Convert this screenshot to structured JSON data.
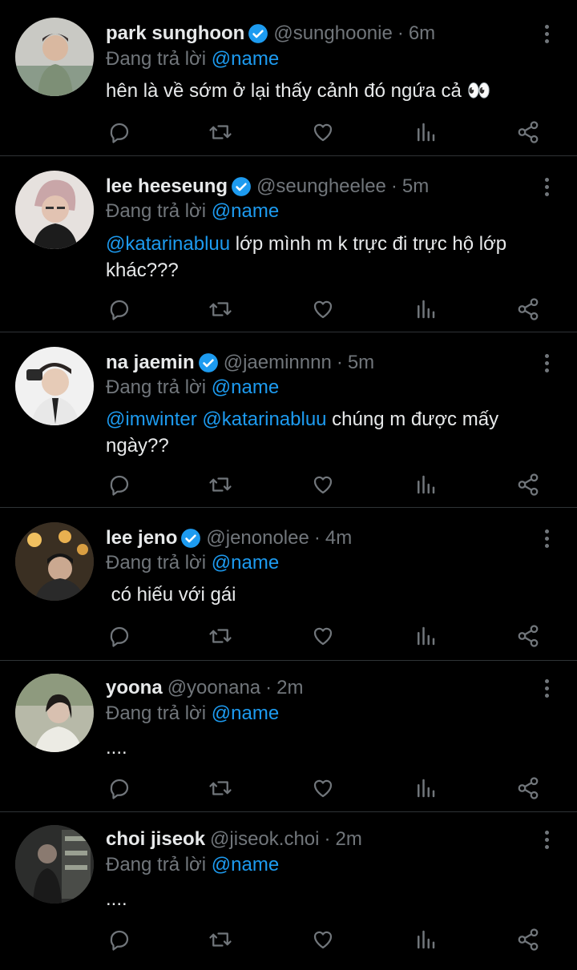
{
  "replying_prefix": "Đang trả lời",
  "colors": {
    "background": "#000000",
    "text": "#e7e9ea",
    "muted": "#71767b",
    "accent": "#1d9bf0",
    "divider": "#2f3336"
  },
  "tweets": [
    {
      "name": "park sunghoon",
      "verified": true,
      "handle": "@sunghoonie",
      "time": "6m",
      "reply_to": "@name",
      "text_parts": [
        "hên là về sớm ở lại thấy cảnh đó ngứa cả 👀"
      ]
    },
    {
      "name": "lee heeseung",
      "verified": true,
      "handle": "@seungheelee",
      "time": "5m",
      "reply_to": "@name",
      "text_parts": [
        "@katarinabluu",
        " lớp mình m k trực đi trực hộ lớp khác???"
      ]
    },
    {
      "name": "na jaemin",
      "verified": true,
      "handle": "@jaeminnnn",
      "time": "5m",
      "reply_to": "@name",
      "text_parts": [
        "@imwinter",
        " ",
        "@katarinabluu",
        " chúng m được mấy ngày??"
      ]
    },
    {
      "name": "lee jeno",
      "verified": true,
      "handle": "@jenonolee",
      "time": "4m",
      "reply_to": "@name",
      "text_parts": [
        " có hiếu với gái"
      ]
    },
    {
      "name": "yoona",
      "verified": false,
      "handle": "@yoonana",
      "time": "2m",
      "reply_to": "@name",
      "text_parts": [
        "...."
      ]
    },
    {
      "name": "choi jiseok",
      "verified": false,
      "handle": "@jiseok.choi",
      "time": "2m",
      "reply_to": "@name",
      "text_parts": [
        "...."
      ]
    }
  ],
  "icons": [
    "reply-icon",
    "retweet-icon",
    "like-icon",
    "views-icon",
    "share-icon",
    "more-icon",
    "verified-badge-icon"
  ]
}
